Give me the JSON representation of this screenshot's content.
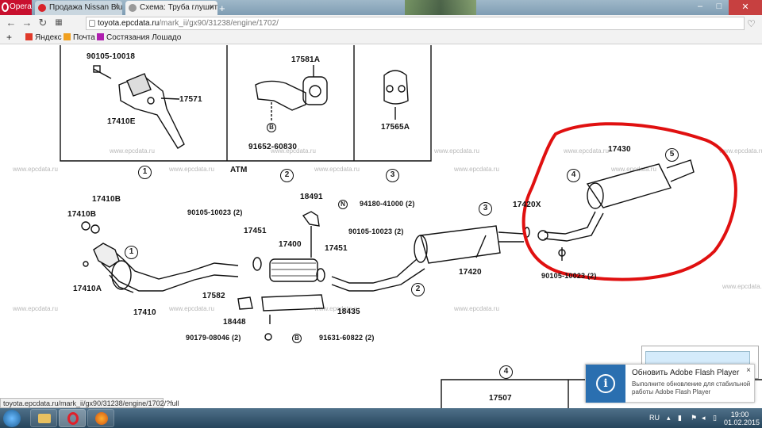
{
  "browser": {
    "menu_label": "Opera",
    "tabs": [
      {
        "label": "Продажа Nissan Bluebird",
        "active": false
      },
      {
        "label": "Схема: Труба глушителя",
        "active": true
      }
    ],
    "new_tab": "+",
    "window_buttons": [
      "–",
      "□",
      "✕"
    ]
  },
  "address": {
    "host": "toyota.epcdata.ru",
    "path": "/mark_ii/gx90/31238/engine/1702/"
  },
  "bookmarks": [
    {
      "label": "Яндекс",
      "color": "#e03a2a"
    },
    {
      "label": "Почта",
      "color": "#f0a020"
    },
    {
      "label": "Состязания Лошадо",
      "color": "#b020b0"
    }
  ],
  "diagram": {
    "watermark": "www.epcdata.ru",
    "part_labels": [
      "90105-10018",
      "17571",
      "17410E",
      "17581A",
      "91652-60830",
      "17565A",
      "ATM",
      "17430",
      "17410B",
      "17410B",
      "90105-10023 (2)",
      "18491",
      "94180-41000 (2)",
      "17451",
      "17400",
      "90105-10023 (2)",
      "17451",
      "17420",
      "17420X",
      "90105-10023 (2)",
      "17410A",
      "17410",
      "17582",
      "18435",
      "18448",
      "90179-08046 (2)",
      "91631-60822 (2)",
      "17507"
    ],
    "circled": [
      "1",
      "2",
      "3",
      "4",
      "5",
      "1",
      "2",
      "3",
      "4"
    ],
    "bolt_markers": [
      "B",
      "N",
      "B"
    ]
  },
  "notification": {
    "title": "Обновить Adobe Flash Player",
    "text": "Выполните обновление для стабильной работы Adobe Flash Player",
    "close": "×"
  },
  "status_url": "toyota.epcdata.ru/mark_ii/gx90/31238/engine/1702/?full",
  "taskbar": {
    "lang": "RU",
    "time": "19:00",
    "date": "01.02.2015"
  },
  "colors": {
    "highlight": "#e01010",
    "tab_active": "#f2f2f2",
    "opera_red": "#c8102e"
  }
}
